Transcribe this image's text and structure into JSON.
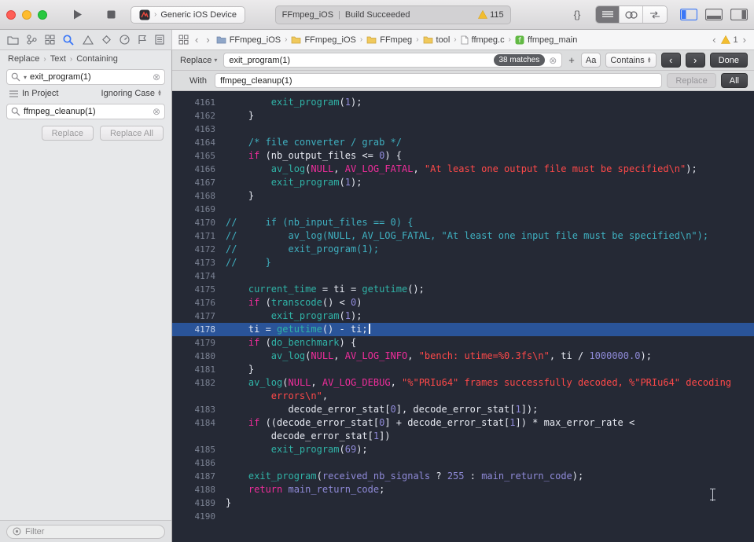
{
  "window": {
    "scheme_device": "Generic iOS Device",
    "status_project": "FFmpeg_iOS",
    "status_message": "Build Succeeded",
    "warning_count": "115",
    "braces_label": "{}"
  },
  "jumpbar": {
    "path": [
      "FFmpeg_iOS",
      "FFmpeg_iOS",
      "FFmpeg",
      "tool",
      "ffmpeg.c",
      "ffmpeg_main"
    ],
    "issue_count": "1"
  },
  "sidebar": {
    "scope": [
      "Replace",
      "Text",
      "Containing"
    ],
    "search_value": "exit_program(1)",
    "in_project": "In Project",
    "ignoring_case": "Ignoring Case",
    "replace_value": "ffmpeg_cleanup(1)",
    "replace_button": "Replace",
    "replace_all_button": "Replace All",
    "filter_placeholder": "Filter"
  },
  "findbar": {
    "mode": "Replace",
    "search_value": "exit_program(1)",
    "matches": "38 matches",
    "add_label": "+",
    "case_label": "Aa",
    "contains_label": "Contains",
    "done_label": "Done",
    "with_label": "With",
    "with_value": "ffmpeg_cleanup(1)",
    "replace_label": "Replace",
    "all_label": "All"
  },
  "colors": {
    "accent_blue": "#3b77f7",
    "warning_yellow": "#f2bd2f",
    "editor_background": "#252935",
    "line_highlight": "#2a5499",
    "keyword": "#ef2d9b",
    "string": "#ff4949",
    "number": "#8f8ad8",
    "function": "#30b3a7",
    "comment": "#3fb0c0",
    "plain_text": "#e7eaf2",
    "line_number": "#7b8293"
  },
  "editor": {
    "lines": [
      {
        "num": "4161",
        "segs": [
          [
            "p",
            "        "
          ],
          [
            "f",
            "exit_program"
          ],
          [
            "p",
            "("
          ],
          [
            "n",
            "1"
          ],
          [
            "p",
            ");"
          ]
        ]
      },
      {
        "num": "4162",
        "segs": [
          [
            "p",
            "    }"
          ]
        ]
      },
      {
        "num": "4163",
        "segs": []
      },
      {
        "num": "4164",
        "segs": [
          [
            "p",
            "    "
          ],
          [
            "c",
            "/* file converter / grab */"
          ]
        ]
      },
      {
        "num": "4165",
        "segs": [
          [
            "p",
            "    "
          ],
          [
            "k",
            "if"
          ],
          [
            "p",
            " (nb_output_files <= "
          ],
          [
            "n",
            "0"
          ],
          [
            "p",
            ") {"
          ]
        ]
      },
      {
        "num": "4166",
        "segs": [
          [
            "p",
            "        "
          ],
          [
            "f",
            "av_log"
          ],
          [
            "p",
            "("
          ],
          [
            "k",
            "NULL"
          ],
          [
            "p",
            ", "
          ],
          [
            "k",
            "AV_LOG_FATAL"
          ],
          [
            "p",
            ", "
          ],
          [
            "s",
            "\"At least one output file must be specified\\n\""
          ],
          [
            "p",
            ");"
          ]
        ]
      },
      {
        "num": "4167",
        "segs": [
          [
            "p",
            "        "
          ],
          [
            "f",
            "exit_program"
          ],
          [
            "p",
            "("
          ],
          [
            "n",
            "1"
          ],
          [
            "p",
            ");"
          ]
        ]
      },
      {
        "num": "4168",
        "segs": [
          [
            "p",
            "    }"
          ]
        ]
      },
      {
        "num": "4169",
        "segs": []
      },
      {
        "num": "4170",
        "segs": [
          [
            "c",
            "//     if (nb_input_files == 0) {"
          ]
        ]
      },
      {
        "num": "4171",
        "segs": [
          [
            "c",
            "//         av_log(NULL, AV_LOG_FATAL, \"At least one input file must be specified\\n\");"
          ]
        ]
      },
      {
        "num": "4172",
        "segs": [
          [
            "c",
            "//         exit_program(1);"
          ]
        ]
      },
      {
        "num": "4173",
        "segs": [
          [
            "c",
            "//     }"
          ]
        ]
      },
      {
        "num": "4174",
        "segs": []
      },
      {
        "num": "4175",
        "segs": [
          [
            "p",
            "    "
          ],
          [
            "f",
            "current_time"
          ],
          [
            "p",
            " = ti = "
          ],
          [
            "f",
            "getutime"
          ],
          [
            "p",
            "();"
          ]
        ]
      },
      {
        "num": "4176",
        "segs": [
          [
            "p",
            "    "
          ],
          [
            "k",
            "if"
          ],
          [
            "p",
            " ("
          ],
          [
            "f",
            "transcode"
          ],
          [
            "p",
            "() < "
          ],
          [
            "n",
            "0"
          ],
          [
            "p",
            ")"
          ]
        ]
      },
      {
        "num": "4177",
        "segs": [
          [
            "p",
            "        "
          ],
          [
            "f",
            "exit_program"
          ],
          [
            "p",
            "("
          ],
          [
            "n",
            "1"
          ],
          [
            "p",
            ");"
          ]
        ]
      },
      {
        "num": "4178",
        "hl": true,
        "segs": [
          [
            "p",
            "    ti = "
          ],
          [
            "f",
            "getutime"
          ],
          [
            "p",
            "() - ti;"
          ],
          [
            "caret",
            ""
          ]
        ]
      },
      {
        "num": "4179",
        "segs": [
          [
            "p",
            "    "
          ],
          [
            "k",
            "if"
          ],
          [
            "p",
            " ("
          ],
          [
            "f",
            "do_benchmark"
          ],
          [
            "p",
            ") {"
          ]
        ]
      },
      {
        "num": "4180",
        "segs": [
          [
            "p",
            "        "
          ],
          [
            "f",
            "av_log"
          ],
          [
            "p",
            "("
          ],
          [
            "k",
            "NULL"
          ],
          [
            "p",
            ", "
          ],
          [
            "k",
            "AV_LOG_INFO"
          ],
          [
            "p",
            ", "
          ],
          [
            "s",
            "\"bench: utime=%0.3fs\\n\""
          ],
          [
            "p",
            ", ti / "
          ],
          [
            "n",
            "1000000.0"
          ],
          [
            "p",
            ");"
          ]
        ]
      },
      {
        "num": "4181",
        "segs": [
          [
            "p",
            "    }"
          ]
        ]
      },
      {
        "num": "4182",
        "segs": [
          [
            "p",
            "    "
          ],
          [
            "f",
            "av_log"
          ],
          [
            "p",
            "("
          ],
          [
            "k",
            "NULL"
          ],
          [
            "p",
            ", "
          ],
          [
            "k",
            "AV_LOG_DEBUG"
          ],
          [
            "p",
            ", "
          ],
          [
            "s",
            "\"%\"PRIu64\" frames successfully decoded, %\"PRIu64\" decoding"
          ]
        ]
      },
      {
        "num": "",
        "segs": [
          [
            "p",
            "        "
          ],
          [
            "s",
            "errors\\n\""
          ],
          [
            "p",
            ","
          ]
        ]
      },
      {
        "num": "4183",
        "segs": [
          [
            "p",
            "           decode_error_stat["
          ],
          [
            "n",
            "0"
          ],
          [
            "p",
            "], decode_error_stat["
          ],
          [
            "n",
            "1"
          ],
          [
            "p",
            "]);"
          ]
        ]
      },
      {
        "num": "4184",
        "segs": [
          [
            "p",
            "    "
          ],
          [
            "k",
            "if"
          ],
          [
            "p",
            " ((decode_error_stat["
          ],
          [
            "n",
            "0"
          ],
          [
            "p",
            "] + decode_error_stat["
          ],
          [
            "n",
            "1"
          ],
          [
            "p",
            "]) * max_error_rate <"
          ]
        ]
      },
      {
        "num": "",
        "segs": [
          [
            "p",
            "        decode_error_stat["
          ],
          [
            "n",
            "1"
          ],
          [
            "p",
            "])"
          ]
        ]
      },
      {
        "num": "4185",
        "segs": [
          [
            "p",
            "        "
          ],
          [
            "f",
            "exit_program"
          ],
          [
            "p",
            "("
          ],
          [
            "n",
            "69"
          ],
          [
            "p",
            ");"
          ]
        ]
      },
      {
        "num": "4186",
        "segs": []
      },
      {
        "num": "4187",
        "segs": [
          [
            "p",
            "    "
          ],
          [
            "f",
            "exit_program"
          ],
          [
            "p",
            "("
          ],
          [
            "n",
            "received_nb_signals"
          ],
          [
            "p",
            " ? "
          ],
          [
            "n",
            "255"
          ],
          [
            "p",
            " : "
          ],
          [
            "n",
            "main_return_code"
          ],
          [
            "p",
            ");"
          ]
        ]
      },
      {
        "num": "4188",
        "segs": [
          [
            "p",
            "    "
          ],
          [
            "k",
            "return"
          ],
          [
            "p",
            " "
          ],
          [
            "n",
            "main_return_code"
          ],
          [
            "p",
            ";"
          ]
        ]
      },
      {
        "num": "4189",
        "segs": [
          [
            "p",
            "}"
          ]
        ]
      },
      {
        "num": "4190",
        "segs": []
      }
    ]
  }
}
